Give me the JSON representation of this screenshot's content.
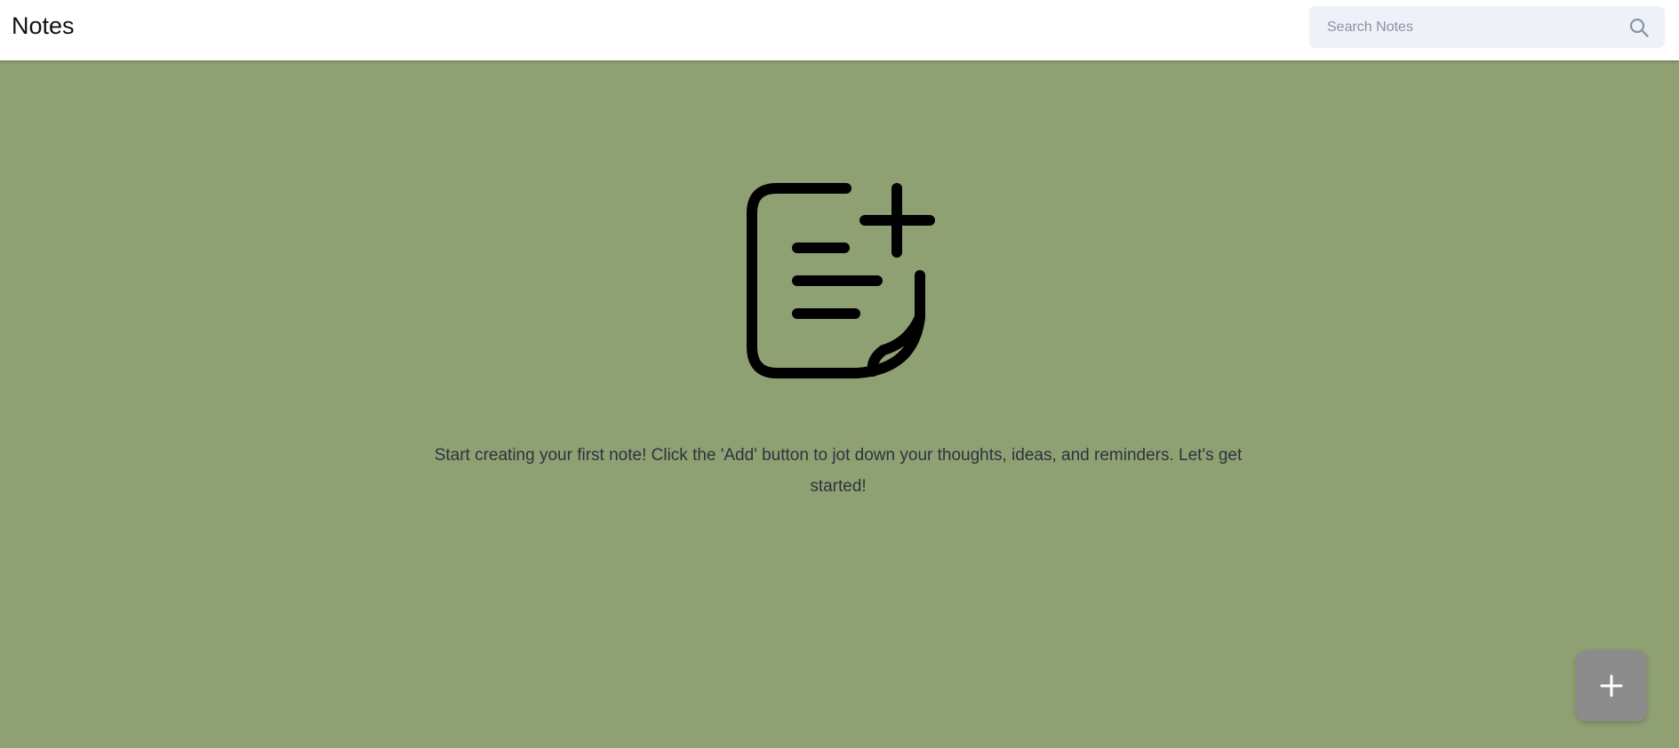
{
  "header": {
    "title": "Notes",
    "search": {
      "placeholder": "Search Notes",
      "value": "",
      "icon": "search-icon"
    }
  },
  "empty_state": {
    "icon": "note-add-icon",
    "message": "Start creating your first note! Click the 'Add' button to jot down your thoughts, ideas, and reminders. Let's get started!"
  },
  "fab": {
    "icon": "plus-icon"
  },
  "colors": {
    "background": "#8fa072",
    "header": "#ffffff",
    "search_field": "#eef1f7",
    "fab": "#8c8c8c",
    "message_text": "#2c3440"
  }
}
